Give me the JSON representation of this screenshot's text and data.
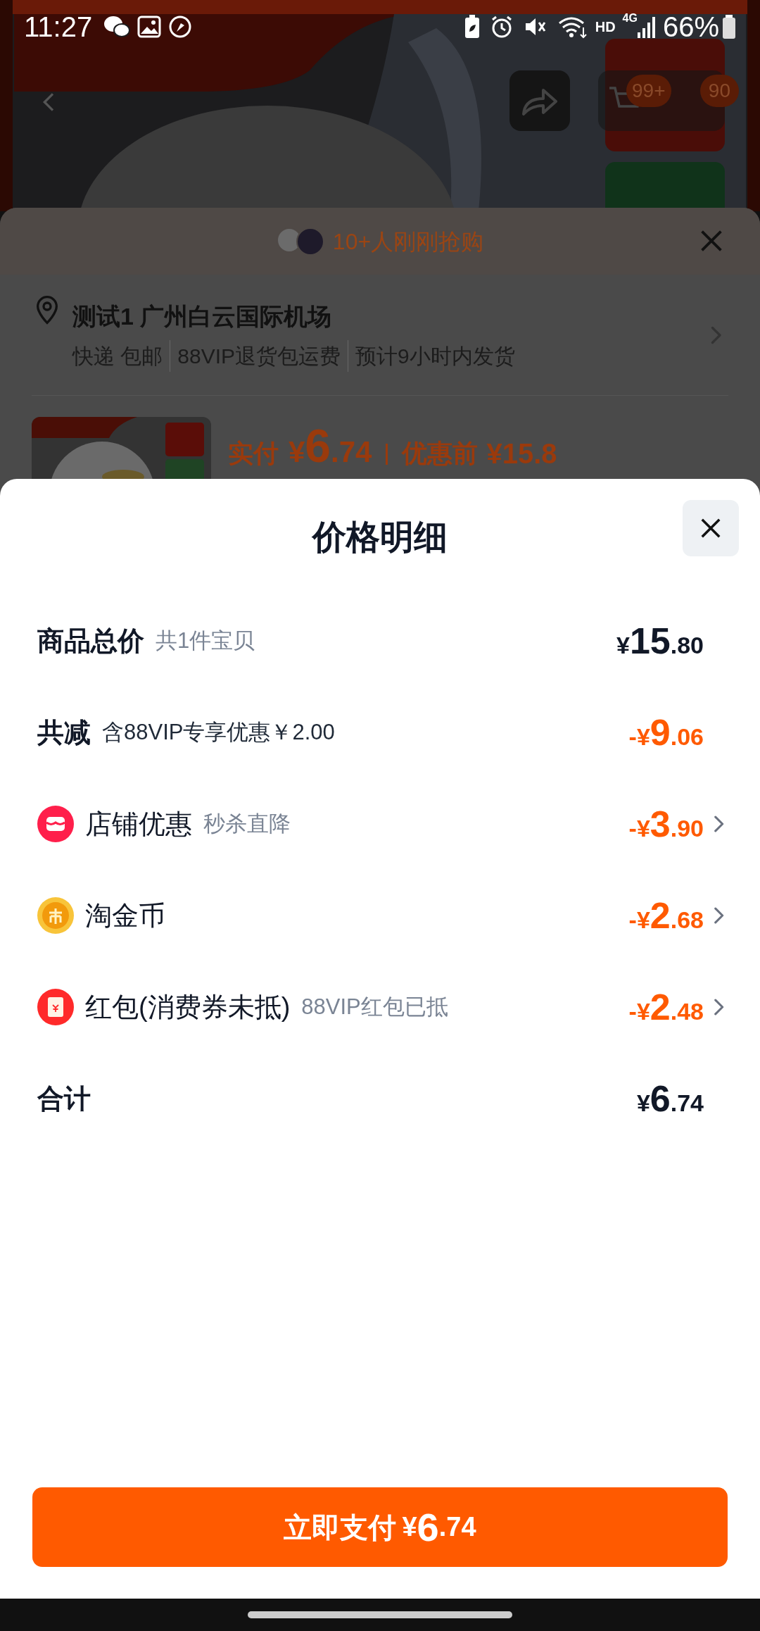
{
  "status_bar": {
    "time": "11:27",
    "network": "HD",
    "cell": "4G",
    "battery": "66%"
  },
  "product_header": {
    "cart_badge": "99+",
    "badge_2": "90"
  },
  "order_sheet": {
    "buyers_text": "10+人刚刚抢购",
    "address": {
      "title": "测试1 广州白云国际机场",
      "details": [
        "快递 包邮",
        "88VIP退货包运费",
        "预计9小时内发货"
      ]
    },
    "product": {
      "paid_label": "实付",
      "paid": {
        "prefix": "¥",
        "main": "6",
        "fraction": ".74"
      },
      "original_label": "优惠前",
      "original_price": "¥15.8"
    }
  },
  "price_sheet": {
    "title": "价格明细",
    "rows": [
      {
        "kind": "summary",
        "label": "商品总价",
        "note": "共1件宝贝",
        "discounted": false,
        "amount": {
          "prefix": "¥",
          "main": "15",
          "fraction": ".80"
        }
      },
      {
        "kind": "summary",
        "label": "共减",
        "note": "含88VIP专享优惠￥2.00",
        "discounted": true,
        "amount": {
          "prefix": "-¥",
          "main": "9",
          "fraction": ".06"
        }
      },
      {
        "kind": "shop",
        "label": "店铺优惠",
        "note": "秒杀直降",
        "discounted": true,
        "amount": {
          "prefix": "-¥",
          "main": "3",
          "fraction": ".90"
        }
      },
      {
        "kind": "coin",
        "label": "淘金币",
        "discounted": true,
        "amount": {
          "prefix": "-¥",
          "main": "2",
          "fraction": ".68"
        }
      },
      {
        "kind": "red_packet",
        "label": "红包(消费券未抵)",
        "note": "88VIP红包已抵",
        "discounted": true,
        "amount": {
          "prefix": "-¥",
          "main": "2",
          "fraction": ".48"
        }
      },
      {
        "kind": "summary",
        "label": "合计",
        "discounted": false,
        "amount": {
          "prefix": "¥",
          "main": "6",
          "fraction": ".74"
        }
      }
    ],
    "pay_button": {
      "label": "立即支付",
      "amount": {
        "prefix": "¥",
        "main": "6",
        "fraction": ".74"
      }
    }
  }
}
